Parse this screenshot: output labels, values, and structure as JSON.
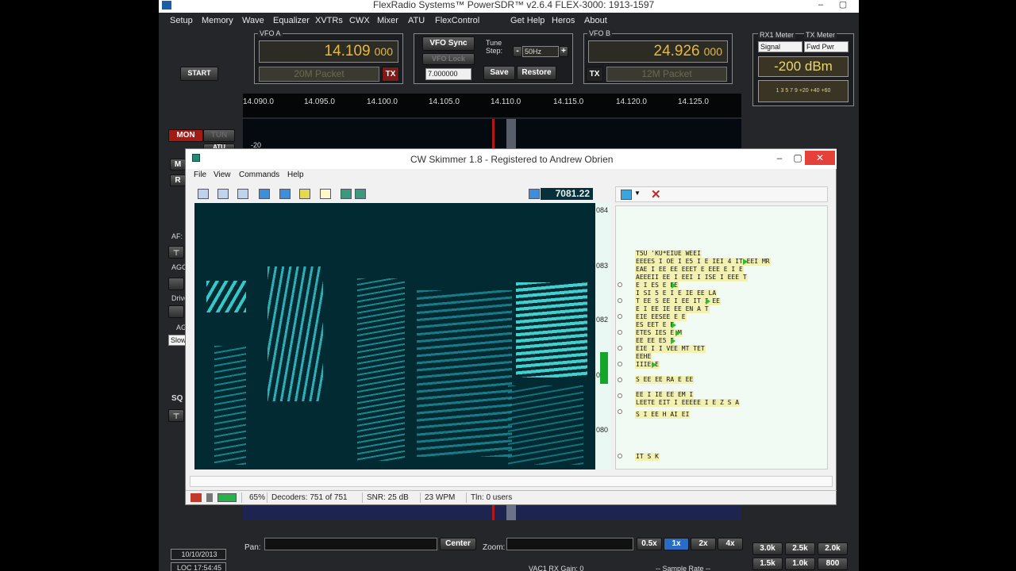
{
  "app_title": "FlexRadio Systems™  PowerSDR™  v2.6.4   FLEX-3000: 1913-1597",
  "menu": [
    "Setup",
    "Memory",
    "Wave",
    "Equalizer",
    "XVTRs",
    "CWX",
    "Mixer",
    "ATU",
    "FlexControl",
    "Get Help",
    "Heros",
    "About"
  ],
  "vfo_a": {
    "label": "VFO A",
    "freq": "14.109",
    "sub": "000",
    "band": "20M Packet",
    "tx": "TX"
  },
  "vfo_b": {
    "label": "VFO B",
    "freq": "24.926",
    "sub": "000",
    "band": "12M Packet",
    "tx": "TX"
  },
  "center": {
    "sync": "VFO Sync",
    "lock": "VFO Lock",
    "tune_label": "Tune Step:",
    "tune_value": "50Hz",
    "offset": "7.000000",
    "save": "Save",
    "restore": "Restore"
  },
  "meter": {
    "rx_label": "RX1 Meter",
    "tx_label": "TX Meter",
    "rx_sel": "Signal",
    "tx_sel": "Fwd Pwr",
    "reading": "-200 dBm",
    "scale": "1  3  5  7  9    +20  +40  +60"
  },
  "start": "START",
  "scale_labels": [
    "14.090.0",
    "14.095.0",
    "14.100.0",
    "14.105.0",
    "14.110.0",
    "14.115.0",
    "14.120.0",
    "14.125.0"
  ],
  "left_buttons": {
    "mon": "MON",
    "tun": "TUN",
    "atu": "ATU",
    "m": "M",
    "r": "R"
  },
  "left_labels": {
    "af": "AF:",
    "agc": "AGC",
    "drive": "Drive",
    "ag": "AG",
    "slow": "Slow",
    "sq": "SQ",
    "db": "-20"
  },
  "bottom": {
    "pan": "Pan:",
    "center": "Center",
    "zoom": "Zoom:",
    "zooms": [
      "0.5x",
      "1x",
      "2x",
      "4x"
    ],
    "date": "10/10/2013",
    "loc": "LOC 17:54:45",
    "vac": "VAC1 RX Gain: 0",
    "sample": "-- Sample Rate --",
    "filters": [
      "3.0k",
      "2.5k",
      "2.0k",
      "1.5k",
      "1.0k",
      "800"
    ]
  },
  "skimmer": {
    "title": "CW Skimmer 1.8 - Registered to Andrew Obrien",
    "menu": [
      "File",
      "View",
      "Commands",
      "Help"
    ],
    "freq": "7081.22",
    "axis": [
      "084",
      "083",
      "082",
      "081",
      "080"
    ],
    "decodes": [
      "T5U 'KU*EIUE  WEEI",
      "EEEES I OE I E5 I E IEI 4 IT EEI MR",
      "EAE I EE EE EEET E EEE E I E",
      "AEEEII EE I EEI I ISE I EEE T",
      "E I ES E EE",
      "I SI 5 E I E IE EE LA",
      "T EE S EE I EE IT I EE",
      "E I EE IE EE EN A T",
      "EIE EESEE E E",
      "ES EET E E",
      "ETES IES E M",
      "EE EE E5 I",
      "EIE I I VEE MT TET",
      "EEHE",
      "IIIE E",
      "S EE EE RA E EE",
      "EE I IE EE EM I",
      "LEETE EIT I EEEEE I E Z S A",
      "S I EE H AI EI",
      "IT S K"
    ],
    "status": {
      "pct": "65%",
      "decoders": "Decoders: 751 of 751",
      "snr": "SNR: 25 dB",
      "wpm": "23 WPM",
      "tln": "Tln: 0 users"
    }
  }
}
